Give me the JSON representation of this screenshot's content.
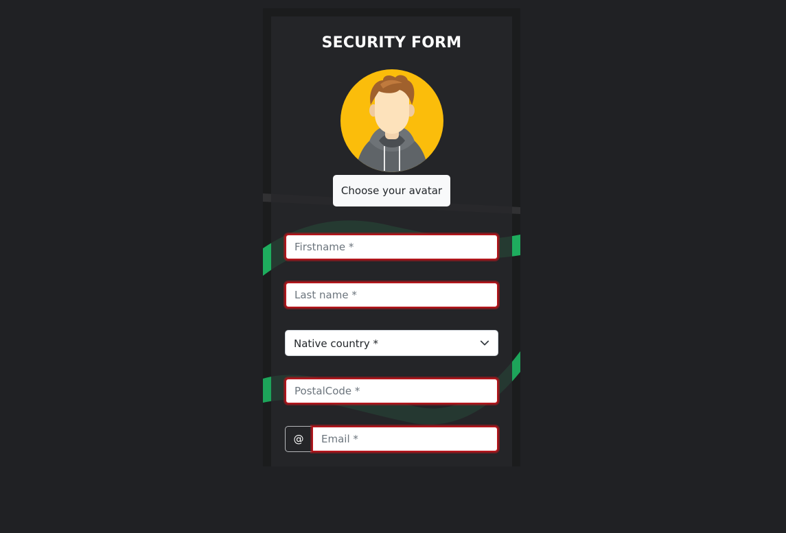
{
  "form": {
    "title": "SECURITY FORM",
    "avatar_button": "Choose your avatar",
    "firstname_placeholder": "Firstname *",
    "lastname_placeholder": "Last name *",
    "country_selected": "Native country *",
    "postal_placeholder": "PostalCode *",
    "email_prefix": "@",
    "email_placeholder": "Email *"
  },
  "colors": {
    "page_background": "#202124",
    "avatar_background": "#fbbd0b",
    "invalid_border": "#b4151b",
    "accent_green": "#1ec76a"
  },
  "icons": {
    "avatar": "user-hoodie-icon",
    "select": "chevron-down-icon"
  }
}
